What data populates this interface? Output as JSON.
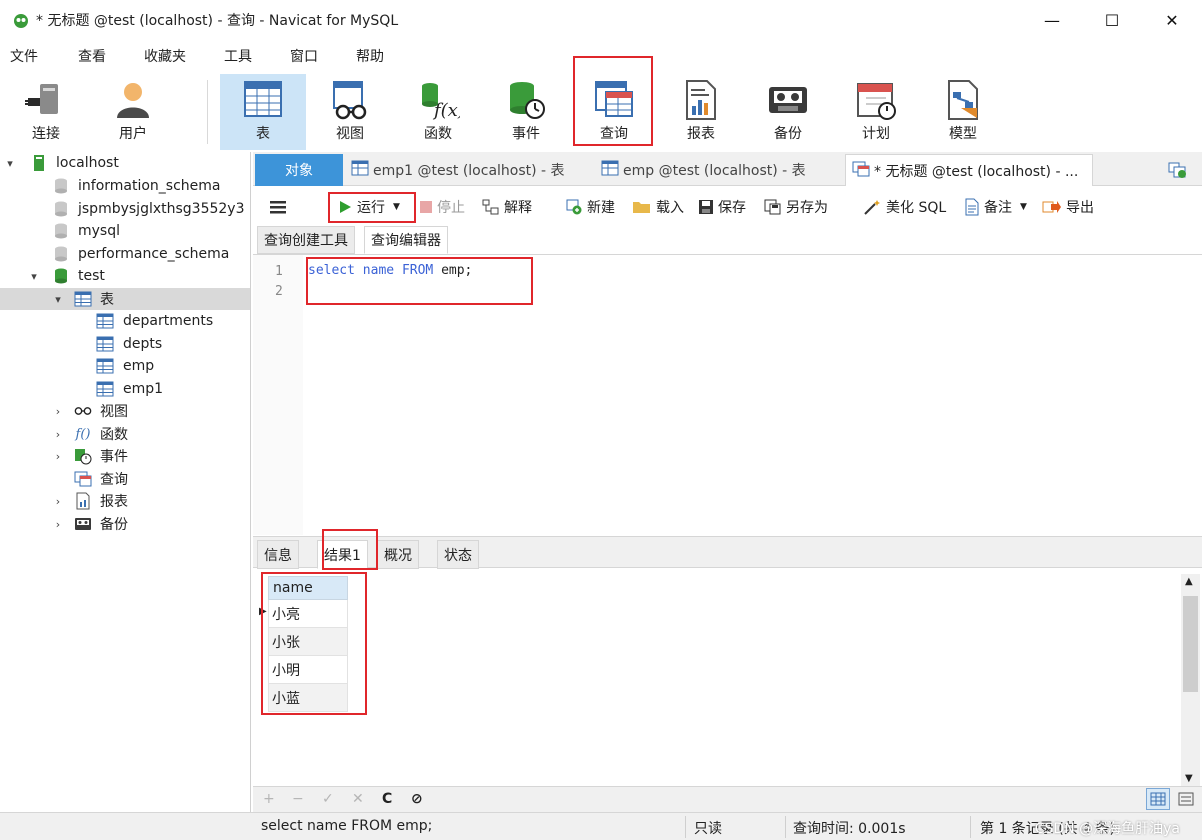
{
  "window": {
    "title": "* 无标题 @test (localhost) - 查询 - Navicat for MySQL",
    "minimize": "—",
    "maximize": "☐",
    "close": "✕"
  },
  "menu": [
    "文件",
    "查看",
    "收藏夹",
    "工具",
    "窗口",
    "帮助"
  ],
  "toolbar": {
    "connect": "连接",
    "user": "用户",
    "table": "表",
    "view": "视图",
    "function": "函数",
    "event": "事件",
    "query": "查询",
    "report": "报表",
    "backup": "备份",
    "schedule": "计划",
    "model": "模型"
  },
  "tree": {
    "connection": "localhost",
    "databases": [
      "information_schema",
      "jspmbysjglxthsg3552y3",
      "mysql",
      "performance_schema"
    ],
    "current_db": "test",
    "tables_node": "表",
    "tables": [
      "departments",
      "depts",
      "emp",
      "emp1"
    ],
    "views": "视图",
    "functions": "函数",
    "events": "事件",
    "queries": "查询",
    "reports": "报表",
    "backups": "备份"
  },
  "doctabs": {
    "objects": "对象",
    "tab1": "emp1 @test (localhost) - 表",
    "tab2": "emp @test (localhost) - 表",
    "tab3": "* 无标题 @test (localhost) - ..."
  },
  "query_toolbar": {
    "run": "运行",
    "stop": "停止",
    "explain": "解释",
    "new": "新建",
    "load": "载入",
    "save": "保存",
    "save_as": "另存为",
    "beautify": "美化 SQL",
    "note": "备注",
    "export": "导出"
  },
  "subtabs": {
    "builder": "查询创建工具",
    "editor": "查询编辑器"
  },
  "editor": {
    "line1": "1",
    "line2": "2",
    "kw_select": "select",
    "ident_name": "name",
    "kw_from": "FROM",
    "ident_table": "emp;"
  },
  "result_tabs": {
    "info": "信息",
    "result1": "结果1",
    "profile": "概况",
    "status": "状态"
  },
  "result": {
    "columns": [
      "name"
    ],
    "rows": [
      [
        "小亮"
      ],
      [
        "小张"
      ],
      [
        "小明"
      ],
      [
        "小蓝"
      ]
    ]
  },
  "gridbar": {
    "add": "+",
    "remove": "−",
    "apply": "✓",
    "discard": "✕",
    "refresh": "C",
    "stop": "⊘"
  },
  "status": {
    "sql": "select name FROM emp;",
    "readonly": "只读",
    "query_time": "查询时间: 0.001s",
    "records": "第 1 条记录 (共 4 条)",
    "watermark": "CSDN @深海鱼肝油ya"
  },
  "colors": {
    "highlight_box": "#e0262b",
    "active_tab": "#3d94d9",
    "sql_keyword": "#3b62d6",
    "selected_tool": "#cce4f7"
  }
}
